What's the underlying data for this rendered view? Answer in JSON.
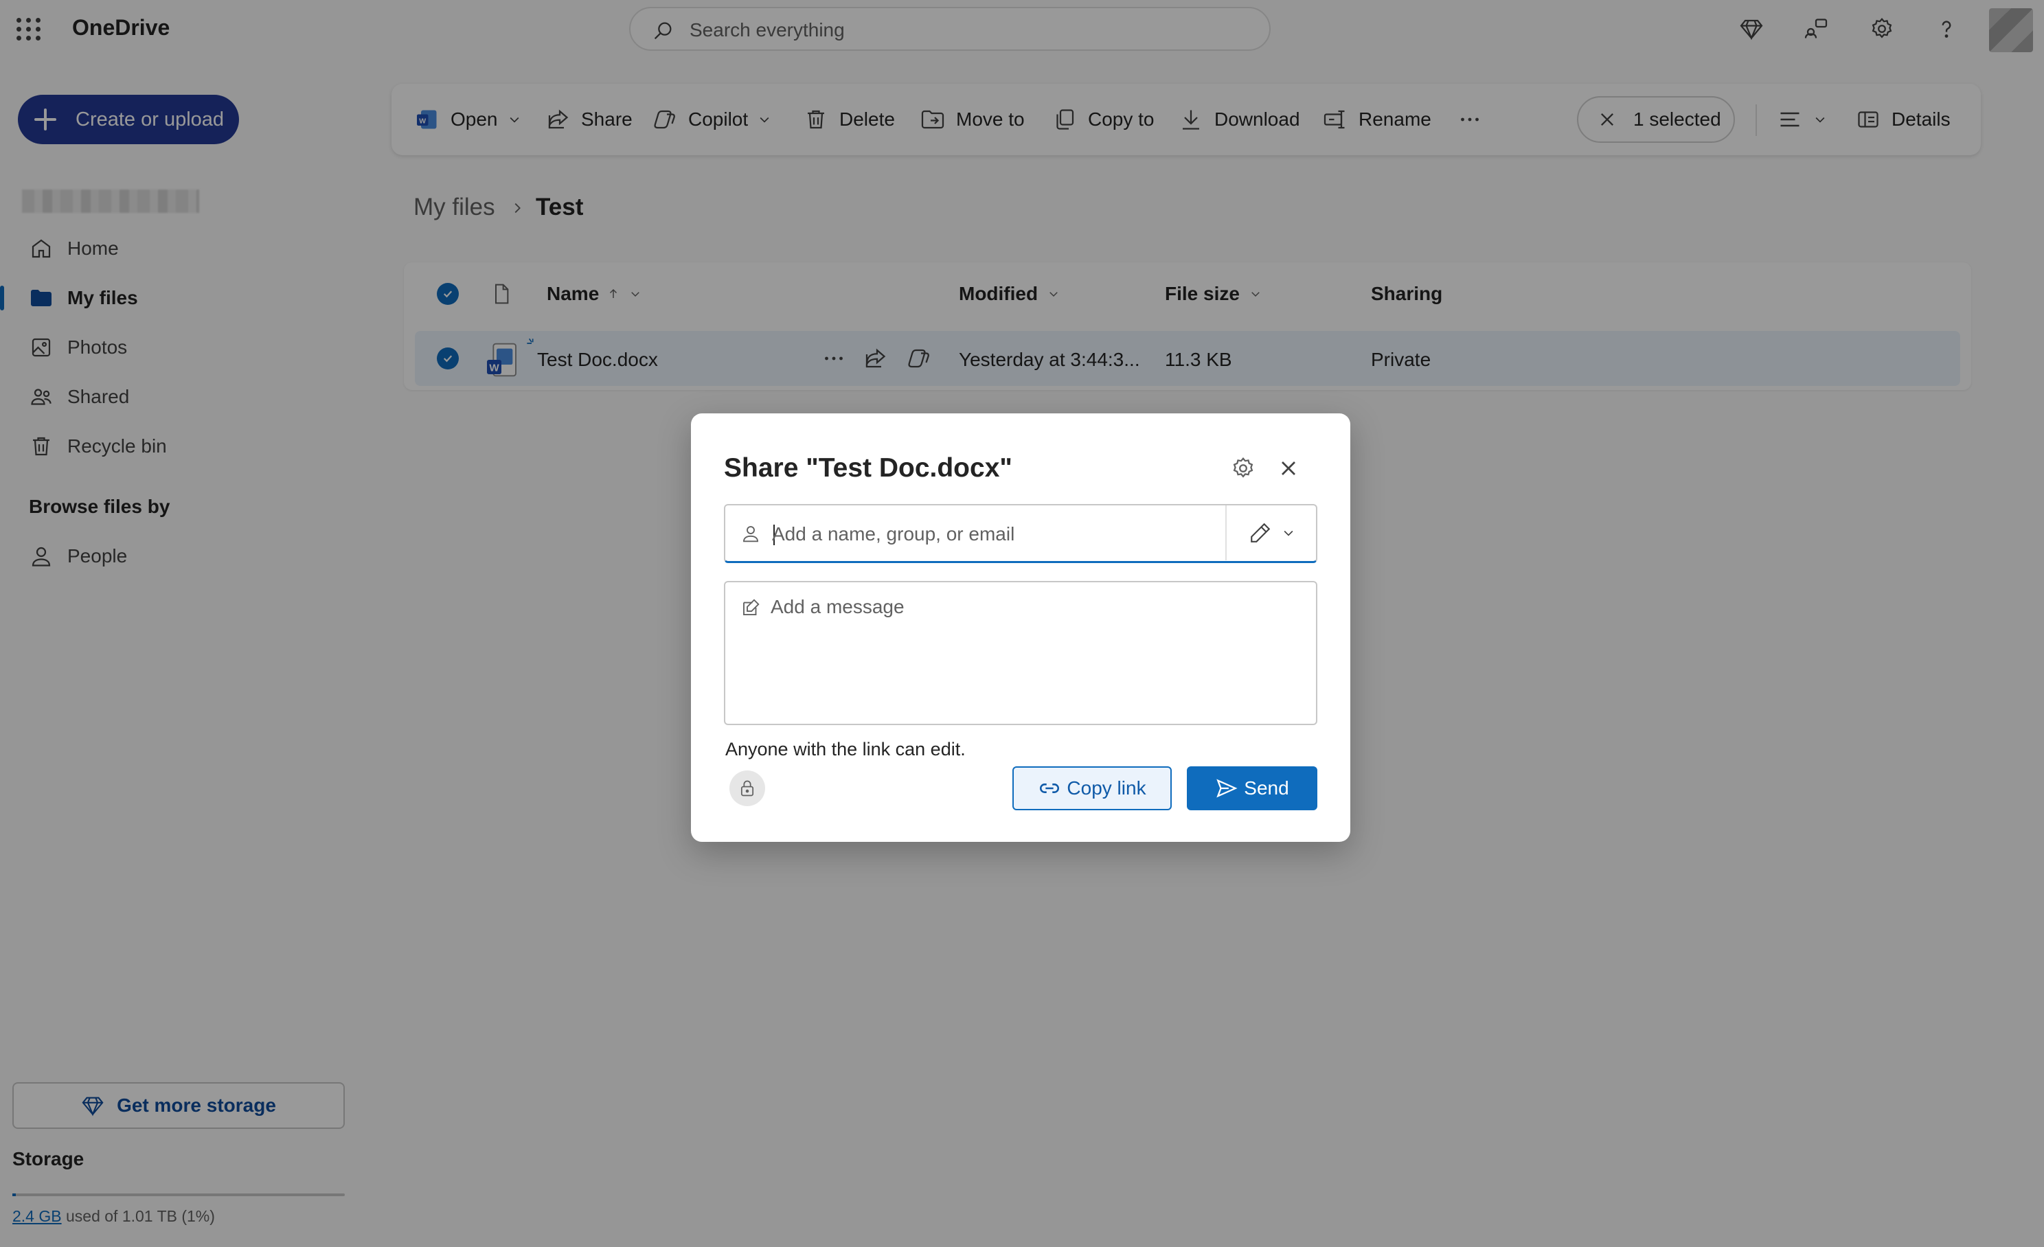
{
  "app": {
    "name": "OneDrive"
  },
  "search": {
    "placeholder": "Search everything"
  },
  "topbar_icons": [
    "premium-diamond-icon",
    "share-feedback-icon",
    "settings-gear-icon",
    "help-question-icon"
  ],
  "sidebar": {
    "create_label": "Create or upload",
    "items": [
      {
        "label": "Home",
        "icon": "home-icon"
      },
      {
        "label": "My files",
        "icon": "folder-icon",
        "active": true
      },
      {
        "label": "Photos",
        "icon": "photo-icon"
      },
      {
        "label": "Shared",
        "icon": "people-shared-icon"
      },
      {
        "label": "Recycle bin",
        "icon": "trash-icon"
      }
    ],
    "browse_heading": "Browse files by",
    "browse_items": [
      {
        "label": "People",
        "icon": "person-icon"
      }
    ],
    "storage_button": "Get more storage",
    "storage_title": "Storage",
    "storage_used": "2.4 GB",
    "storage_rest": "used of 1.01 TB (1%)",
    "storage_fraction": 0.01
  },
  "commandbar": {
    "open": "Open",
    "share": "Share",
    "copilot": "Copilot",
    "delete": "Delete",
    "move_to": "Move to",
    "copy_to": "Copy to",
    "download": "Download",
    "rename": "Rename",
    "selected": "1 selected",
    "details": "Details"
  },
  "breadcrumb": {
    "root": "My files",
    "current": "Test"
  },
  "filelist": {
    "headers": {
      "name": "Name",
      "modified": "Modified",
      "size": "File size",
      "sharing": "Sharing"
    },
    "rows": [
      {
        "name": "Test Doc.docx",
        "modified": "Yesterday at 3:44:3...",
        "size": "11.3 KB",
        "sharing": "Private"
      }
    ]
  },
  "share_dialog": {
    "title": "Share \"Test Doc.docx\"",
    "people_placeholder": "Add a name, group, or email",
    "message_placeholder": "Add a message",
    "link_description": "Anyone with the link can edit.",
    "copy_link": "Copy link",
    "send": "Send"
  },
  "colors": {
    "accent": "#0f6cbd",
    "create_button": "#243a94"
  }
}
